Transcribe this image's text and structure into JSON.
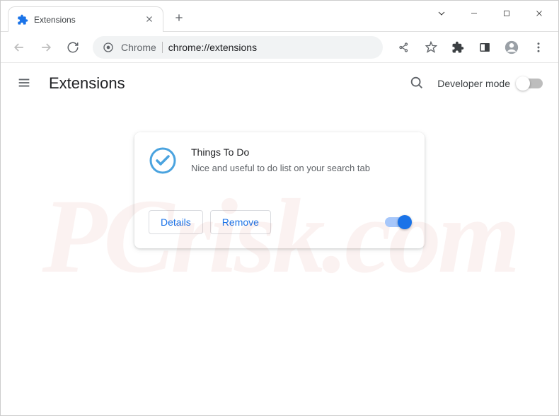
{
  "window": {
    "tab_title": "Extensions",
    "close_label": "×"
  },
  "toolbar": {
    "url_origin": "Chrome",
    "url_path": "chrome://extensions"
  },
  "page": {
    "title": "Extensions",
    "developer_mode_label": "Developer mode",
    "developer_mode_on": false
  },
  "extension": {
    "name": "Things To Do",
    "description": "Nice and useful to do list on your search tab",
    "details_label": "Details",
    "remove_label": "Remove",
    "enabled": true
  },
  "watermark": "PCrisk.com"
}
